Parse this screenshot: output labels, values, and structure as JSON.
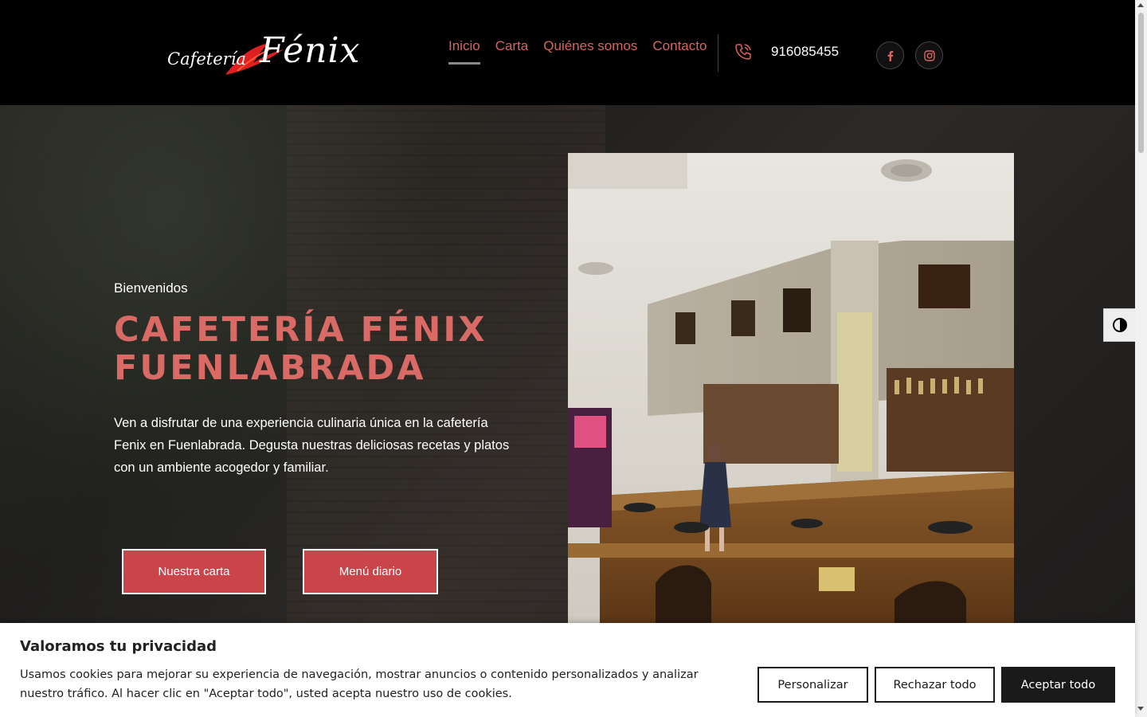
{
  "header": {
    "logo": {
      "script_text": "Cafetería",
      "main_text": "Fénix"
    },
    "nav": [
      {
        "label": "Inicio",
        "active": true
      },
      {
        "label": "Carta",
        "active": false
      },
      {
        "label": "Quiénes somos",
        "active": false
      },
      {
        "label": "Contacto",
        "active": false
      }
    ],
    "phone": "916085455",
    "phone_icon": "phone-icon",
    "social": [
      {
        "icon": "facebook-icon"
      },
      {
        "icon": "instagram-icon"
      }
    ]
  },
  "hero": {
    "welcome": "Bienvenidos",
    "title": "CAFETERÍA FÉNIX FUENLABRADA",
    "description": "Ven a disfrutar de una experiencia culinaria única en la cafetería Fenix en Fuenlabrada. Degusta nuestras deliciosas recetas y platos con un ambiente acogedor y familiar.",
    "buttons": {
      "carta": "Nuestra carta",
      "menu": "Menú diario"
    }
  },
  "contrast_toggle_icon": "contrast-icon",
  "cookie_banner": {
    "title": "Valoramos tu privacidad",
    "text": "Usamos cookies para mejorar su experiencia de navegación, mostrar anuncios o contenido personalizados y analizar nuestro tráfico. Al hacer clic en \"Aceptar todo\", usted acepta nuestro uso de cookies.",
    "buttons": {
      "customize": "Personalizar",
      "reject": "Rechazar todo",
      "accept": "Aceptar todo"
    }
  },
  "colors": {
    "accent": "#d9645f",
    "button": "#c9454a",
    "header_bg": "#000000",
    "cookie_dark": "#1a1a1a"
  }
}
